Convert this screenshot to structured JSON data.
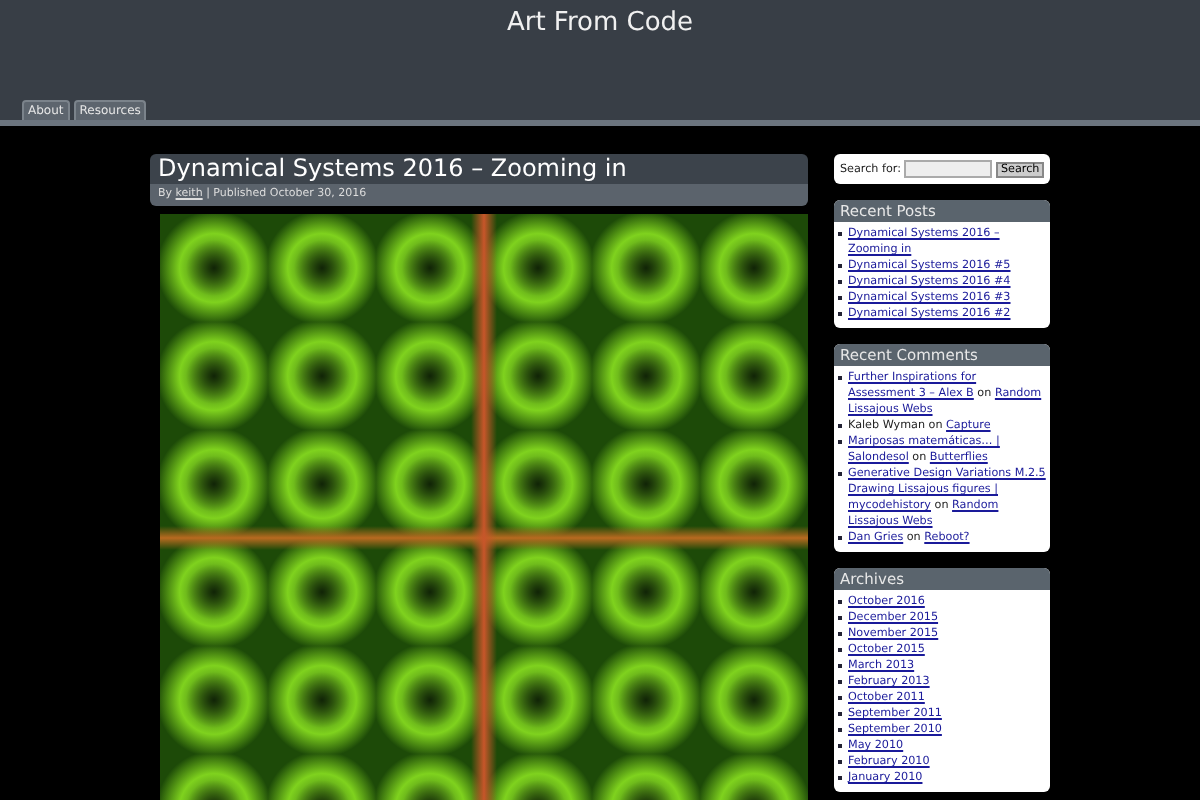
{
  "site": {
    "title": "Art From Code"
  },
  "nav": [
    {
      "label": "About"
    },
    {
      "label": "Resources"
    }
  ],
  "post": {
    "title": "Dynamical Systems 2016 – Zooming in",
    "by": "By",
    "author": "keith",
    "published": "| Published October 30, 2016"
  },
  "search": {
    "label": "Search for:",
    "button": "Search"
  },
  "recent_posts": {
    "title": "Recent Posts",
    "items": [
      "Dynamical Systems 2016 – Zooming in",
      "Dynamical Systems 2016 #5",
      "Dynamical Systems 2016 #4",
      "Dynamical Systems 2016 #3",
      "Dynamical Systems 2016 #2"
    ]
  },
  "recent_comments": {
    "title": "Recent Comments",
    "items": [
      {
        "author": "Further Inspirations for Assessment 3 – Alex B",
        "author_link": true,
        "on": "on",
        "post": "Random Lissajous Webs"
      },
      {
        "author": "Kaleb Wyman",
        "author_link": false,
        "on": "on",
        "post": "Capture"
      },
      {
        "author": "Mariposas matemáticas… | Salondesol",
        "author_link": true,
        "on": "on",
        "post": "Butterflies"
      },
      {
        "author": "Generative Design Variations M.2.5 Drawing Lissajous figures | mycodehistory",
        "author_link": true,
        "on": "on",
        "post": "Random Lissajous Webs"
      },
      {
        "author": "Dan Gries",
        "author_link": true,
        "on": "on",
        "post": "Reboot?"
      }
    ]
  },
  "archives": {
    "title": "Archives",
    "items": [
      "October 2016",
      "December 2015",
      "November 2015",
      "October 2015",
      "March 2013",
      "February 2013",
      "October 2011",
      "September 2011",
      "September 2010",
      "May 2010",
      "February 2010",
      "January 2010"
    ]
  }
}
